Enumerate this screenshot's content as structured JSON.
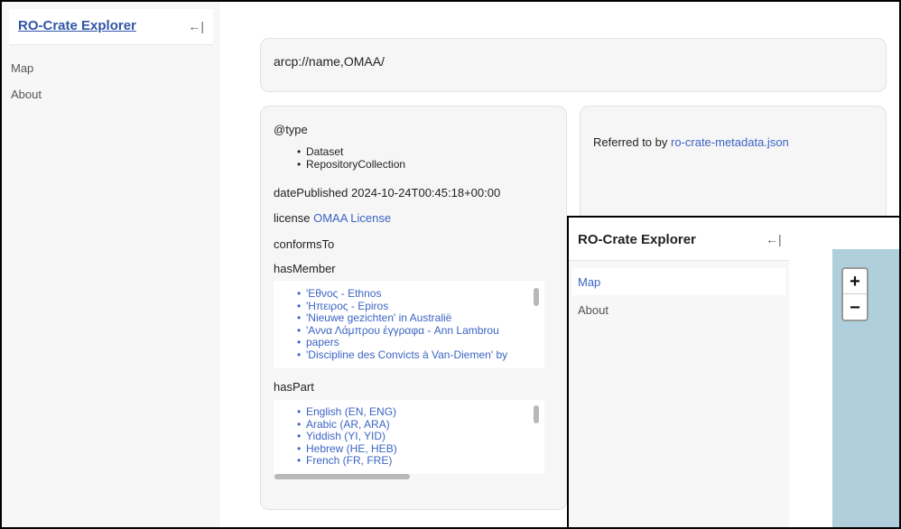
{
  "app": {
    "title": "RO-Crate Explorer",
    "collapse_icon": "←|"
  },
  "sidebar": {
    "items": [
      {
        "label": "Map"
      },
      {
        "label": "About"
      }
    ]
  },
  "main": {
    "url": "arcp://name,OMAA/",
    "type": {
      "label": "@type",
      "values": [
        "Dataset",
        "RepositoryCollection"
      ]
    },
    "date_published": {
      "label": "datePublished",
      "value": "2024-10-24T00:45:18+00:00"
    },
    "license": {
      "label": "license",
      "value": "OMAA License"
    },
    "conforms_to": {
      "label": "conformsTo"
    },
    "has_member": {
      "label": "hasMember",
      "items": [
        "'Εθνος - Ethnos",
        "'Ηπειρος - Epiros",
        "'Nieuwe gezichten' in Australië",
        "'Αννα Λάμπρου έγγραφα - Ann Lambrou",
        "papers",
        "'Discipline des Convicts à Van-Diemen' by"
      ]
    },
    "has_part": {
      "label": "hasPart",
      "items": [
        "English (EN, ENG)",
        "Arabic (AR, ARA)",
        "Yiddish (YI, YID)",
        "Hebrew (HE, HEB)",
        "French (FR, FRE)"
      ]
    },
    "referred": {
      "prefix": "Referred to by",
      "link": "ro-crate-metadata.json"
    }
  },
  "window2": {
    "title": "RO-Crate Explorer",
    "collapse_icon": "←|",
    "items": [
      {
        "label": "Map",
        "active": true
      },
      {
        "label": "About",
        "active": false
      }
    ],
    "zoom_in": "+",
    "zoom_out": "−"
  },
  "colors": {
    "link": "#3b64c4",
    "map_water": "#aecfdb",
    "sidebar_bg": "#f7f7f7"
  }
}
